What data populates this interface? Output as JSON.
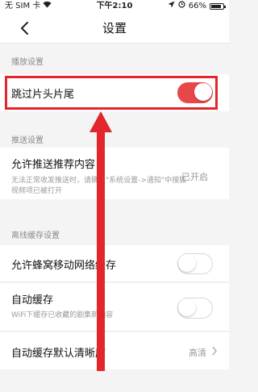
{
  "status_bar": {
    "carrier": "无 SIM 卡",
    "time": "下午2:10",
    "battery_percent": "66%"
  },
  "nav": {
    "title": "设置"
  },
  "playback": {
    "section_label": "播放设置",
    "skip_intro_label": "跳过片头片尾",
    "skip_intro_on": true
  },
  "push": {
    "section_label": "推送设置",
    "allow_push_label": "允许推送推荐内容",
    "allow_push_sub": "无法正常收发推送时，请确认\"系统设置->通知\"中搜狐视频项已被打开",
    "allow_push_status": "已开启"
  },
  "cache": {
    "section_label": "离线缓存设置",
    "cellular_label": "允许蜂窝移动网络缓存",
    "cellular_on": false,
    "auto_cache_label": "自动缓存",
    "auto_cache_sub": "WiFi下缓存已收藏的剧集新内容",
    "auto_cache_on": false,
    "default_quality_label": "自动缓存默认清晰度",
    "default_quality_value": "高清"
  },
  "colors": {
    "accent_red": "#e8474a",
    "annotation_red": "#e2262b"
  }
}
